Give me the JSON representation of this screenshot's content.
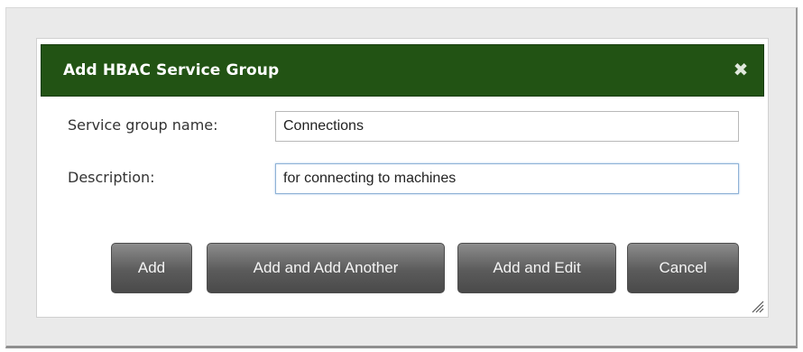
{
  "dialog": {
    "title": "Add HBAC Service Group",
    "close_icon": "close-icon"
  },
  "form": {
    "name_label": "Service group name:",
    "name_value": "Connections",
    "description_label": "Description:",
    "description_value": "for connecting to machines"
  },
  "buttons": {
    "add": "Add",
    "add_and_add_another": "Add and Add Another",
    "add_and_edit": "Add and Edit",
    "cancel": "Cancel"
  },
  "colors": {
    "titlebar": "#225314",
    "button": "#5b5b5b"
  }
}
